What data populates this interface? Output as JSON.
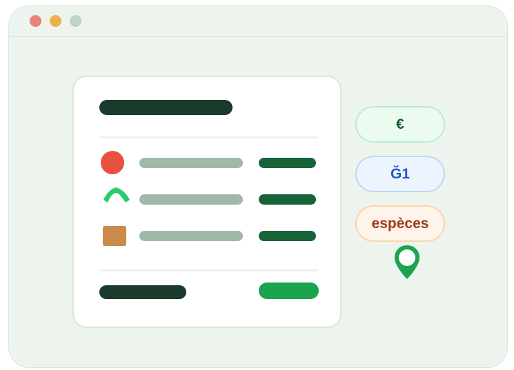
{
  "window": {
    "controls": [
      "close",
      "minimize",
      "maximize"
    ],
    "colors": {
      "close": "#e8837a",
      "minimize": "#edb24c",
      "maximize": "#bcd3c5"
    }
  },
  "receipt": {
    "title_bar_color": "#1a3b2b",
    "items": [
      {
        "icon": "red-circle-icon",
        "icon_color": "#e8503f"
      },
      {
        "icon": "green-arch-icon",
        "icon_color": "#2dca6b"
      },
      {
        "icon": "orange-square-icon",
        "icon_color": "#c98a4b"
      }
    ],
    "line_color": "#a0b8aa",
    "amount_color": "#176338",
    "action_color": "#1ba34f"
  },
  "payment_options": [
    {
      "label": "€",
      "text_color": "#17592f",
      "bg": "#ecfbf0",
      "border": "#b9edc9"
    },
    {
      "label": "Ğ1",
      "text_color": "#2356c9",
      "bg": "#edf4fd",
      "border": "#bcd7f5"
    },
    {
      "label": "espèces",
      "text_color": "#9d3a1c",
      "bg": "#fff4e9",
      "border": "#f7d4ac"
    }
  ],
  "location_pin_color": "#1ba34f"
}
